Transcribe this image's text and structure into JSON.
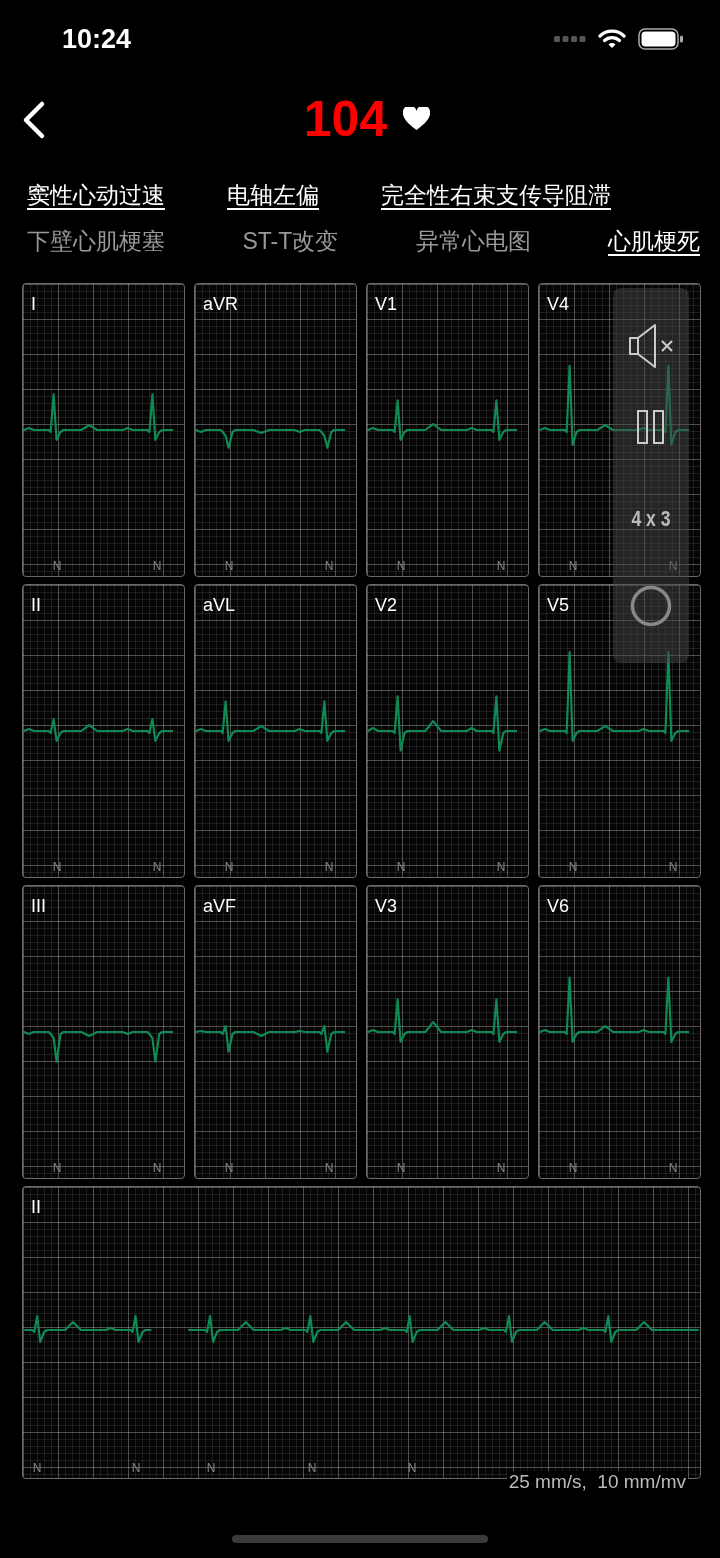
{
  "status_bar": {
    "time": "10:24"
  },
  "header": {
    "heart_rate": "104"
  },
  "diagnoses": [
    {
      "items": [
        {
          "text": "窦性心动过速",
          "highlighted": true
        },
        {
          "text": "电轴左偏",
          "highlighted": true
        },
        {
          "text": "完全性右束支传导阻滞",
          "highlighted": true
        }
      ]
    },
    {
      "items": [
        {
          "text": "下壁心肌梗塞",
          "highlighted": false
        },
        {
          "text": "ST-T改变",
          "highlighted": false
        },
        {
          "text": "异常心电图",
          "highlighted": false
        },
        {
          "text": "心肌梗死",
          "highlighted": true
        }
      ]
    }
  ],
  "leads": [
    {
      "name": "I",
      "beats": [
        "N",
        "N"
      ]
    },
    {
      "name": "aVR",
      "beats": [
        "N",
        "N"
      ]
    },
    {
      "name": "V1",
      "beats": [
        "N",
        "N"
      ]
    },
    {
      "name": "V4",
      "beats": [
        "N",
        "N"
      ]
    },
    {
      "name": "II",
      "beats": [
        "N",
        "N"
      ]
    },
    {
      "name": "aVL",
      "beats": [
        "N",
        "N"
      ]
    },
    {
      "name": "V2",
      "beats": [
        "N",
        "N"
      ]
    },
    {
      "name": "V5",
      "beats": [
        "N",
        "N"
      ]
    },
    {
      "name": "III",
      "beats": [
        "N",
        "N"
      ]
    },
    {
      "name": "aVF",
      "beats": [
        "N",
        "N"
      ]
    },
    {
      "name": "V3",
      "beats": [
        "N",
        "N"
      ]
    },
    {
      "name": "V6",
      "beats": [
        "N",
        "N"
      ]
    }
  ],
  "rhythm_strip": {
    "name": "II",
    "beats": [
      "N",
      "N",
      "N",
      "N",
      "N"
    ]
  },
  "controls": {
    "muted": true,
    "layout": "4 x 3"
  },
  "scale": "25 mm/s,  10 mm/mv"
}
